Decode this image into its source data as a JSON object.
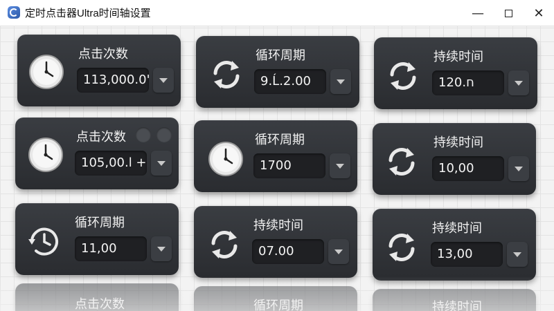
{
  "window": {
    "title": "定时点击器Ultra时间轴设置",
    "min_glyph": "—",
    "close_glyph": "✕"
  },
  "colors": {
    "card_bg": "#2e3034",
    "field_bg": "#1f2023",
    "text": "#f1f1f1",
    "icon_light": "#e9e9e9"
  },
  "cards": [
    {
      "label": "点击次数",
      "value": "113,000.0'",
      "icon": "clock-icon"
    },
    {
      "label": "循环周期",
      "value": "9.Ĺ.2.00",
      "icon": "refresh-icon"
    },
    {
      "label": "持续时间",
      "value": "120.ח",
      "icon": "refresh-icon"
    },
    {
      "label": "点击次数",
      "value": "105,00.l +",
      "icon": "clock-icon"
    },
    {
      "label": "循环周期",
      "value": "1700",
      "icon": "clock-icon"
    },
    {
      "label": "持续时间",
      "value": "10,00",
      "icon": "refresh-icon"
    },
    {
      "label": "循环周期",
      "value": "11,00",
      "icon": "clock-refresh-icon"
    },
    {
      "label": "持续时间",
      "value": "07.00",
      "icon": "refresh-icon"
    },
    {
      "label": "持续时间",
      "value": "13,00",
      "icon": "refresh-icon"
    },
    {
      "label": "点击次数",
      "value": "",
      "icon": "clock-icon"
    },
    {
      "label": "循环周期",
      "value": "",
      "icon": "refresh-icon"
    },
    {
      "label": "持续时间",
      "value": "",
      "icon": "refresh-icon"
    }
  ]
}
